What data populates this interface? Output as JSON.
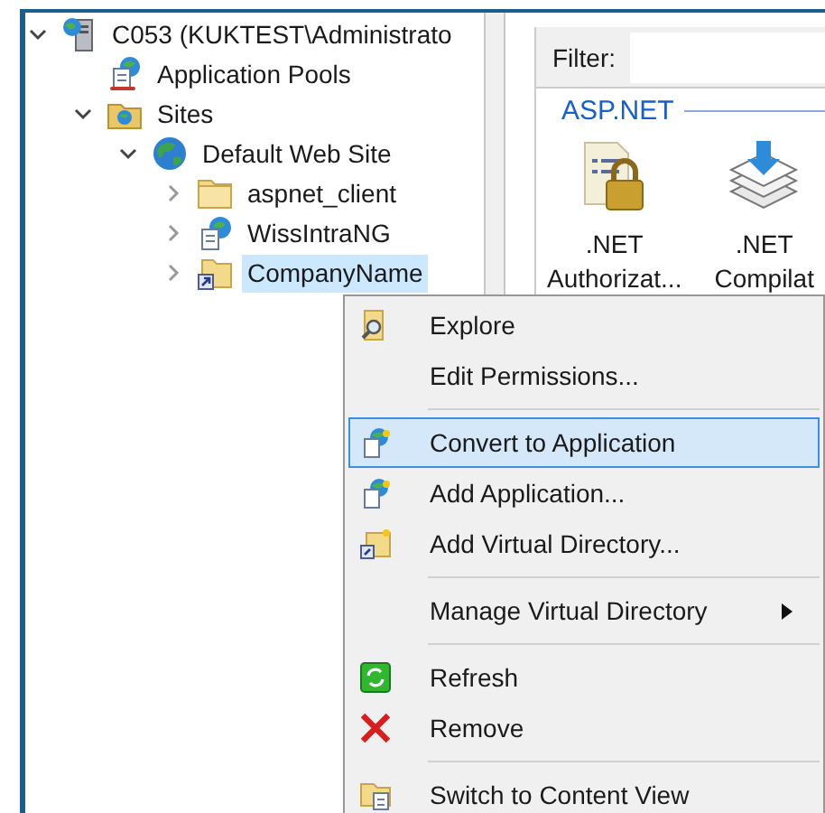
{
  "tree": [
    {
      "label": "C053 (KUKTEST\\Administrato",
      "expanded": true,
      "selected": false,
      "children": [
        {
          "label": "Application Pools",
          "selected": false
        },
        {
          "label": "Sites",
          "expanded": true,
          "selected": false,
          "children": [
            {
              "label": "Default Web Site",
              "expanded": true,
              "selected": false,
              "children": [
                {
                  "label": "aspnet_client",
                  "expanded": false,
                  "selected": false
                },
                {
                  "label": "WissIntraNG",
                  "expanded": false,
                  "selected": false
                },
                {
                  "label": "CompanyName",
                  "expanded": false,
                  "selected": true
                }
              ]
            }
          ]
        }
      ]
    }
  ],
  "filter": {
    "label": "Filter:"
  },
  "group": {
    "title": "ASP.NET",
    "features": [
      {
        "label_lines": [
          ".NET",
          "Authorizat..."
        ]
      },
      {
        "label_lines": [
          ".NET",
          "Compilat"
        ]
      }
    ]
  },
  "context_menu": [
    {
      "kind": "item",
      "label": "Explore",
      "selected": false
    },
    {
      "kind": "item",
      "label": "Edit Permissions...",
      "selected": false
    },
    {
      "kind": "separator"
    },
    {
      "kind": "item",
      "label": "Convert to Application",
      "selected": true
    },
    {
      "kind": "item",
      "label": "Add Application...",
      "selected": false
    },
    {
      "kind": "item",
      "label": "Add Virtual Directory...",
      "selected": false
    },
    {
      "kind": "separator"
    },
    {
      "kind": "submenu",
      "label": "Manage Virtual Directory",
      "selected": false
    },
    {
      "kind": "separator"
    },
    {
      "kind": "item",
      "label": "Refresh",
      "selected": false
    },
    {
      "kind": "item",
      "label": "Remove",
      "selected": false
    },
    {
      "kind": "separator"
    },
    {
      "kind": "item",
      "label": "Switch to Content View",
      "selected": false
    }
  ]
}
